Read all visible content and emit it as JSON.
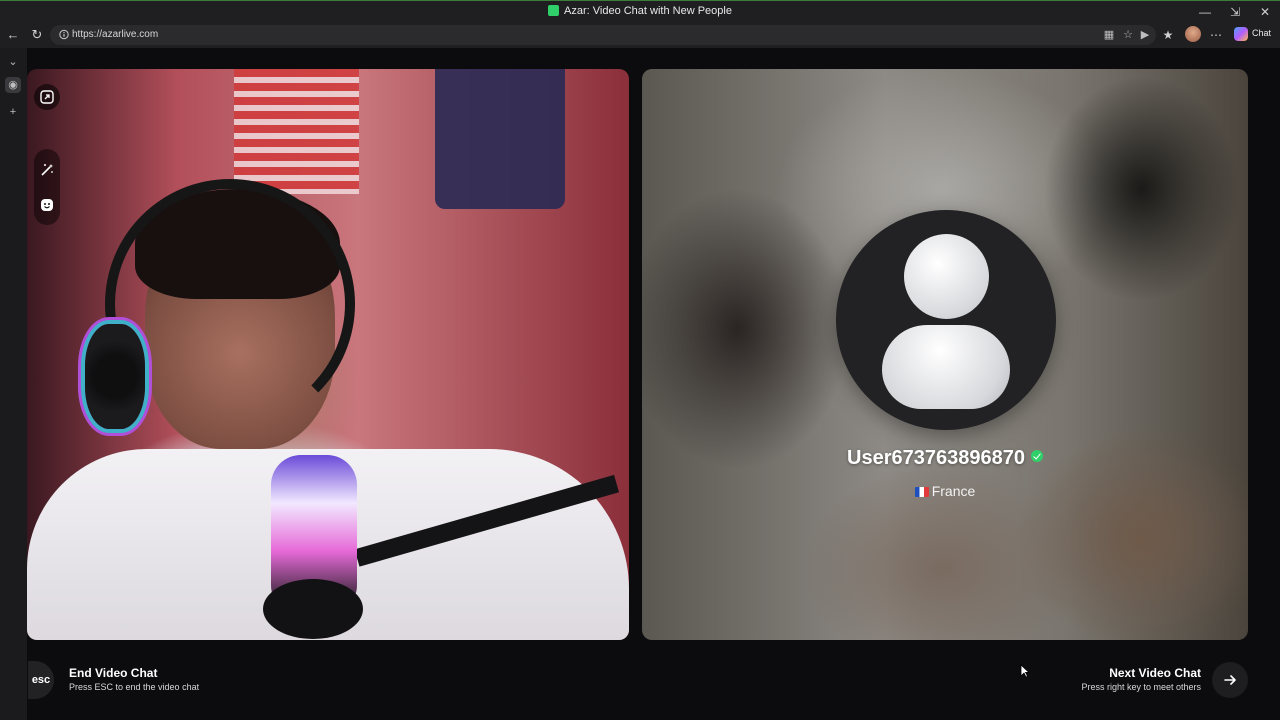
{
  "window": {
    "title": "Azar: Video Chat with New People",
    "controls": [
      "minimize",
      "restore",
      "close"
    ]
  },
  "browser": {
    "url": "https://azarlive.com",
    "copilot_label": "Chat"
  },
  "left_video": {
    "tools": [
      "resize-icon",
      "magic-wand-icon",
      "sticker-face-icon"
    ]
  },
  "partner": {
    "username": "User673763896870",
    "verified": true,
    "country": "France",
    "flag_colors": [
      "#1f4fbf",
      "#ffffff",
      "#e23a3a"
    ]
  },
  "footer": {
    "esc_key": "esc",
    "end_title": "End Video Chat",
    "end_subtitle": "Press ESC to end the video chat",
    "next_title": "Next Video Chat",
    "next_subtitle": "Press right key to meet others"
  },
  "colors": {
    "accent": "#2fd06a",
    "background": "#0c0c0e"
  }
}
